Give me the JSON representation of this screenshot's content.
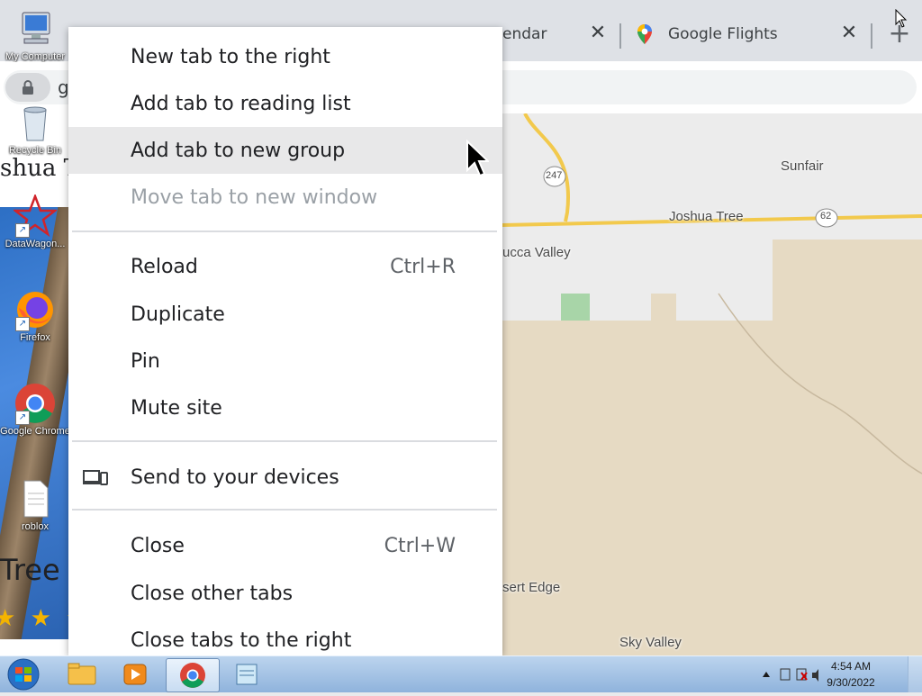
{
  "browser": {
    "tabs": [
      {
        "title": "endar",
        "close": "✕"
      },
      {
        "title": "Google Flights",
        "close": "✕"
      }
    ],
    "new_tab": "+",
    "address_fragment": "g"
  },
  "page": {
    "title_fragment": "shua T",
    "title_tree": "Tree",
    "rating_stars": "★ ★ ★"
  },
  "desktop_icons": [
    {
      "label": "My Computer"
    },
    {
      "label": "Recycle Bin"
    },
    {
      "label": "DataWagon..."
    },
    {
      "label": "Firefox"
    },
    {
      "label": "Google Chrome"
    },
    {
      "label": "roblox"
    }
  ],
  "map": {
    "labels": {
      "sunfair": "Sunfair",
      "joshua_tree": "Joshua Tree",
      "yucca_valley": "ucca Valley",
      "desert_edge": "sert Edge",
      "sky_valley": "Sky Valley",
      "route_247": "247",
      "route_62": "62"
    }
  },
  "context_menu": {
    "items": [
      {
        "label": "New tab to the right"
      },
      {
        "label": "Add tab to reading list"
      },
      {
        "label": "Add tab to new group"
      },
      {
        "label": "Move tab to new window"
      },
      {
        "label": "Reload",
        "shortcut": "Ctrl+R"
      },
      {
        "label": "Duplicate"
      },
      {
        "label": "Pin"
      },
      {
        "label": "Mute site"
      },
      {
        "label": "Send to your devices"
      },
      {
        "label": "Close",
        "shortcut": "Ctrl+W"
      },
      {
        "label": "Close other tabs"
      },
      {
        "label": "Close tabs to the right"
      }
    ]
  },
  "taskbar": {
    "time": "4:54 AM",
    "date": "9/30/2022"
  },
  "colors": {
    "hover": "#e8e8e9",
    "disabled_text": "#9aa0a6",
    "taskbar": "#8fb3dc"
  }
}
